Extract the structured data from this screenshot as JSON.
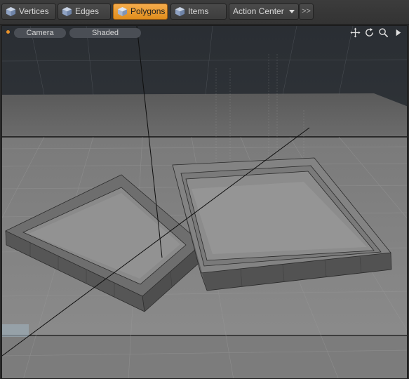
{
  "toolbar": {
    "modes": [
      {
        "label": "Vertices",
        "icon": "vertex-cube-icon",
        "active": false
      },
      {
        "label": "Edges",
        "icon": "edge-cube-icon",
        "active": false
      },
      {
        "label": "Polygons",
        "icon": "polygon-cube-icon",
        "active": true
      },
      {
        "label": "Items",
        "icon": "item-cube-icon",
        "active": false
      }
    ],
    "action_center": {
      "label": "Action Center"
    },
    "more": {
      "label": ">>"
    }
  },
  "viewport": {
    "camera_label": "Camera",
    "shading_label": "Shaded",
    "nav_icons": [
      "move-view-icon",
      "rotate-view-icon",
      "zoom-view-icon",
      "viewport-menu-icon"
    ],
    "colors": {
      "accent": "#e8922a",
      "active_button": "#f0a040",
      "background_upper": "#2e3236",
      "ground_plane": "#8a8a8a",
      "mesh": "#7e7e7e"
    }
  }
}
